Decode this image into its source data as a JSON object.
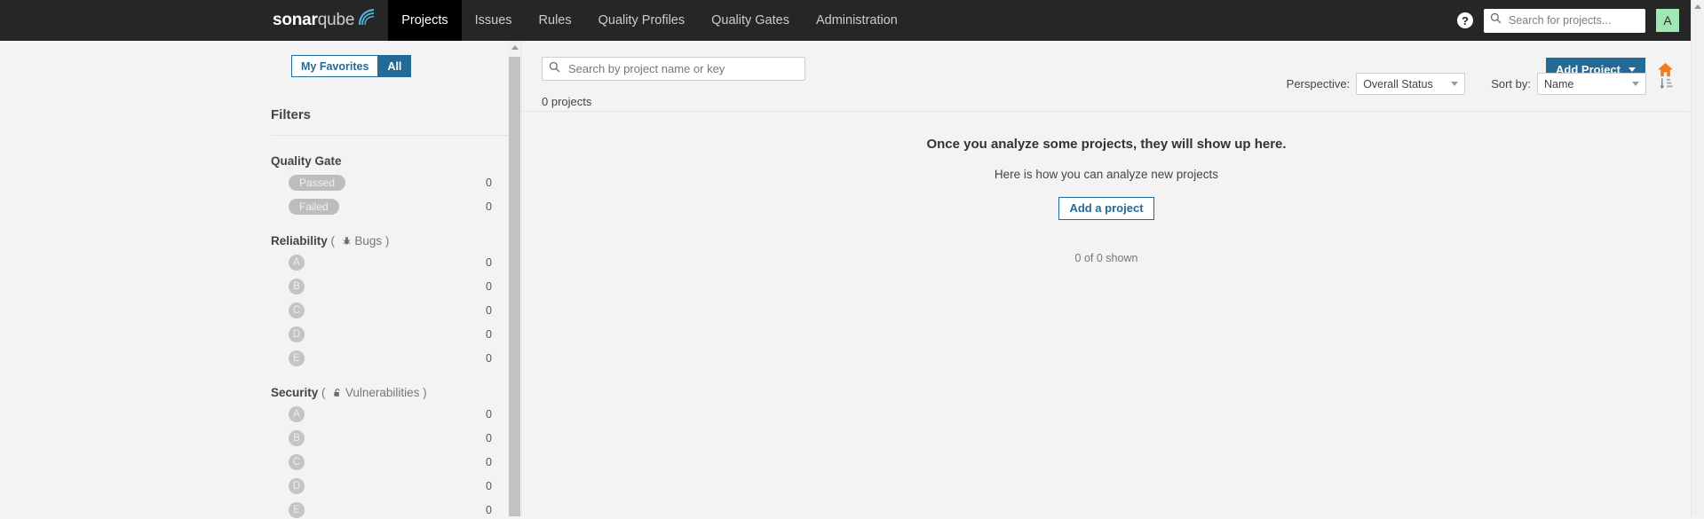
{
  "navbar": {
    "logo_bold": "sonar",
    "logo_light": "qube",
    "items": [
      {
        "label": "Projects",
        "active": true
      },
      {
        "label": "Issues",
        "active": false
      },
      {
        "label": "Rules",
        "active": false
      },
      {
        "label": "Quality Profiles",
        "active": false
      },
      {
        "label": "Quality Gates",
        "active": false
      },
      {
        "label": "Administration",
        "active": false
      }
    ],
    "help_label": "?",
    "search_placeholder": "Search for projects...",
    "search_value": "",
    "avatar_letter": "A",
    "avatar_color": "#a1e6b3",
    "background": "#262626",
    "active_background": "#000000"
  },
  "sidebar": {
    "favorites_toggle": {
      "my_favorites": "My Favorites",
      "all": "All",
      "selected": "All"
    },
    "filters_title": "Filters",
    "facets": [
      {
        "title": "Quality Gate",
        "sub": "",
        "icon": "",
        "kind": "pill",
        "rows": [
          {
            "label": "Passed",
            "count": "0"
          },
          {
            "label": "Failed",
            "count": "0"
          }
        ]
      },
      {
        "title": "Reliability",
        "sub": "Bugs",
        "icon": "bug-icon",
        "kind": "rating",
        "rows": [
          {
            "label": "A",
            "count": "0"
          },
          {
            "label": "B",
            "count": "0"
          },
          {
            "label": "C",
            "count": "0"
          },
          {
            "label": "D",
            "count": "0"
          },
          {
            "label": "E",
            "count": "0"
          }
        ]
      },
      {
        "title": "Security",
        "sub": "Vulnerabilities",
        "icon": "open-lock-icon",
        "kind": "rating",
        "rows": [
          {
            "label": "A",
            "count": "0"
          },
          {
            "label": "B",
            "count": "0"
          },
          {
            "label": "C",
            "count": "0"
          },
          {
            "label": "D",
            "count": "0"
          },
          {
            "label": "E",
            "count": "0"
          }
        ]
      }
    ]
  },
  "main": {
    "search_placeholder": "Search by project name or key",
    "search_value": "",
    "add_project_label": "Add Project",
    "home_icon_color": "#ed7d20",
    "projects_count": "0 projects",
    "perspective_label": "Perspective:",
    "perspective_value": "Overall Status",
    "sort_label": "Sort by:",
    "sort_value": "Name",
    "empty_title": "Once you analyze some projects, they will show up here.",
    "empty_subtitle": "Here is how you can analyze new projects",
    "empty_button": "Add a project",
    "shown_text": "0 of 0 shown"
  },
  "colors": {
    "accent_blue": "#236a97",
    "page_background": "#f3f3f3",
    "rating_badge": "#c4c4c4"
  }
}
